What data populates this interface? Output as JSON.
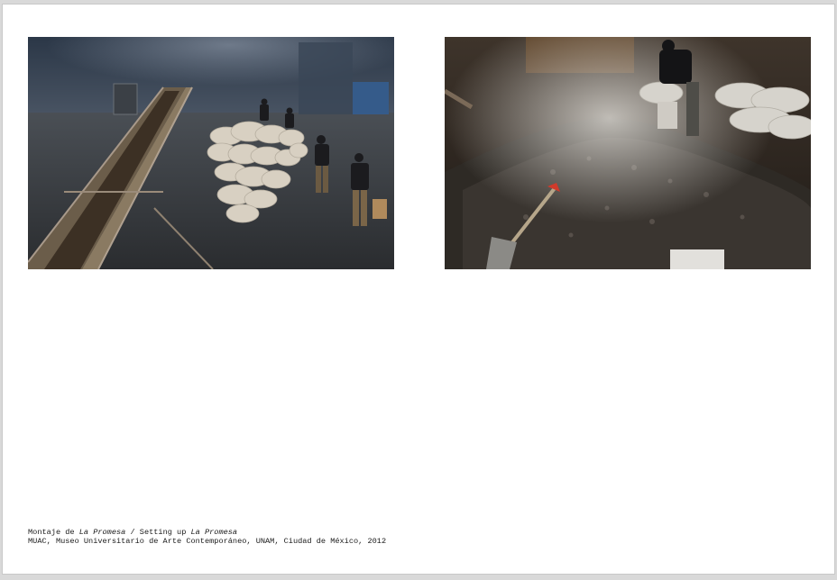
{
  "caption": {
    "line1_prefix": "Montaje de ",
    "line1_title_es": "La Promesa",
    "line1_separator": " / Setting up ",
    "line1_title_en": "La Promesa",
    "line2": "MUAC, Museo Universitario de Arte Contemporáneo, UNAM, Ciudad de México, 2012"
  },
  "colors": {
    "page_background": "#ffffff",
    "frame_background": "#d9d9d9",
    "caption_text": "#1a1a1a"
  }
}
